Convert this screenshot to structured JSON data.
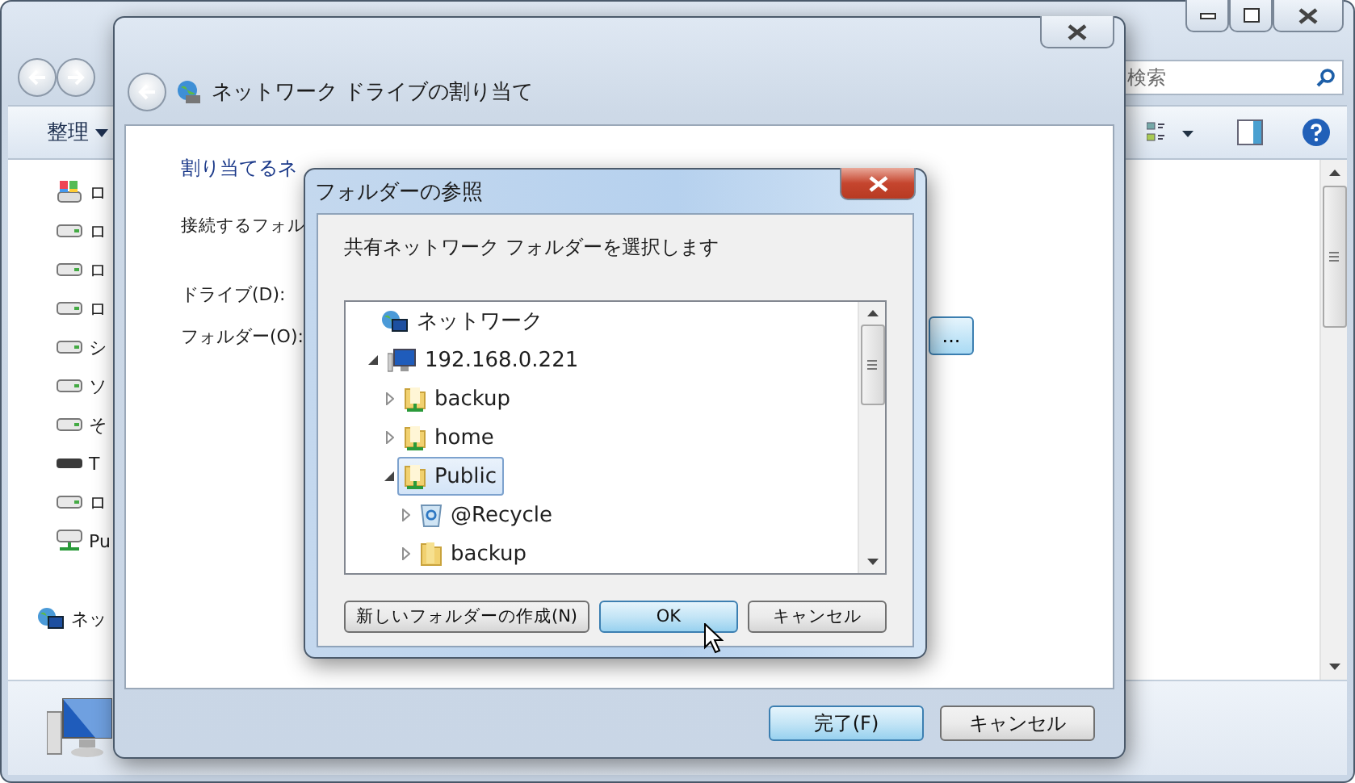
{
  "explorer": {
    "search": {
      "placeholder": "検索"
    },
    "toolbar": {
      "organize": "整理"
    },
    "sidebar": {
      "items": [
        {
          "label": "ロ",
          "kind": "system-drive"
        },
        {
          "label": "ロ",
          "kind": "drive"
        },
        {
          "label": "ロ",
          "kind": "drive"
        },
        {
          "label": "ロ",
          "kind": "drive"
        },
        {
          "label": "シ",
          "kind": "drive"
        },
        {
          "label": "ソ",
          "kind": "drive"
        },
        {
          "label": "そ",
          "kind": "drive"
        },
        {
          "label": "T",
          "kind": "optical"
        },
        {
          "label": "ロ",
          "kind": "drive"
        },
        {
          "label": "Pu",
          "kind": "network-drive"
        }
      ],
      "network": {
        "label": "ネッ"
      }
    }
  },
  "wizard": {
    "title": "ネットワーク ドライブの割り当て",
    "heading": "割り当てるネ",
    "intro": "接続するフォル",
    "drive_label": "ドライブ(D):",
    "folder_label": "フォルダー(O):",
    "browse": "...",
    "buttons": [
      {
        "label": "完了(F)",
        "default": true
      },
      {
        "label": "キャンセル",
        "default": false
      }
    ]
  },
  "dialog": {
    "title": "フォルダーの参照",
    "prompt": "共有ネットワーク フォルダーを選択します",
    "tree": [
      {
        "label": "ネットワーク",
        "kind": "network",
        "selected": false,
        "children": [
          {
            "label": "192.168.0.221",
            "kind": "computer",
            "expanded": true,
            "selected": false,
            "children": [
              {
                "label": "backup",
                "kind": "share",
                "expanded": false,
                "selected": false
              },
              {
                "label": "home",
                "kind": "share",
                "expanded": false,
                "selected": false
              },
              {
                "label": "Public",
                "kind": "share",
                "expanded": true,
                "selected": true,
                "children": [
                  {
                    "label": "@Recycle",
                    "kind": "recycle",
                    "expanded": false,
                    "selected": false
                  },
                  {
                    "label": "backup",
                    "kind": "folder",
                    "expanded": false,
                    "selected": false
                  }
                ]
              }
            ]
          }
        ]
      }
    ],
    "buttons": [
      {
        "label": "新しいフォルダーの作成(N)",
        "default": false
      },
      {
        "label": "OK",
        "default": true
      },
      {
        "label": "キャンセル",
        "default": false
      }
    ]
  }
}
